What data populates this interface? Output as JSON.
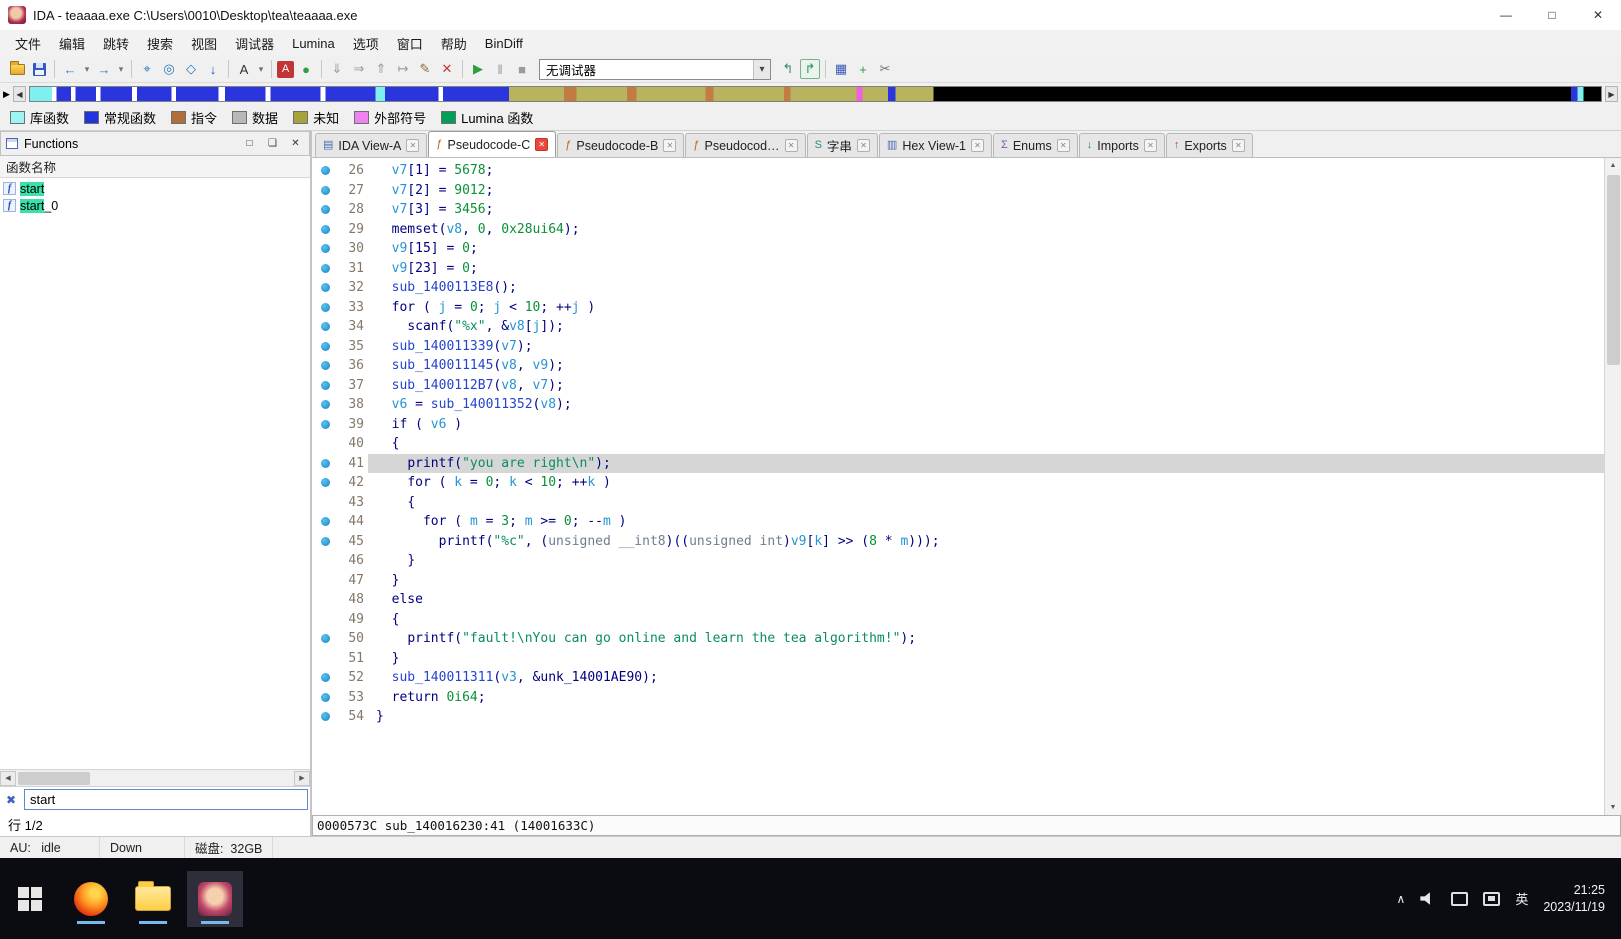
{
  "titlebar": {
    "title": "IDA - teaaaa.exe C:\\Users\\0010\\Desktop\\tea\\teaaaa.exe"
  },
  "menubar": [
    "文件",
    "编辑",
    "跳转",
    "搜索",
    "视图",
    "调试器",
    "Lumina",
    "选项",
    "窗口",
    "帮助",
    "BinDiff"
  ],
  "toolbar": {
    "debugger_label": "无调试器",
    "icons_left": [
      {
        "name": "open-file-icon",
        "cls": "ic-folder"
      },
      {
        "name": "save-icon",
        "cls": "ic-floppy"
      },
      {
        "sep": true
      },
      {
        "name": "nav-back-icon",
        "glyph": "←",
        "color": "#4a78b8"
      },
      {
        "name": "nav-back-history-icon",
        "glyph": "▾",
        "color": "#707070",
        "small": true
      },
      {
        "name": "nav-forward-icon",
        "glyph": "→",
        "color": "#4a78b8"
      },
      {
        "name": "nav-forward-history-icon",
        "glyph": "▾",
        "color": "#707070",
        "small": true
      },
      {
        "sep": true
      },
      {
        "name": "jump-by-name-icon",
        "glyph": "⌖",
        "color": "#2a7ab8"
      },
      {
        "name": "jump-by-xref-icon",
        "glyph": "◎",
        "color": "#2a7ab8"
      },
      {
        "name": "jump-by-address-icon",
        "glyph": "◇",
        "color": "#2a7ab8"
      },
      {
        "name": "jump-next-icon",
        "glyph": "↓",
        "color": "#2255cc"
      },
      {
        "sep": true
      },
      {
        "name": "font-select-icon",
        "glyph": "A",
        "color": "#303030"
      },
      {
        "name": "font-select-menu-icon",
        "glyph": "▾",
        "color": "#707070",
        "small": true
      },
      {
        "sep": true
      },
      {
        "name": "highlight-color-icon",
        "glyph": "A",
        "color": "#ffffff",
        "bg": "#c23535"
      },
      {
        "name": "lumina-status-icon",
        "glyph": "●",
        "color": "#2f9e3f"
      },
      {
        "sep": true
      },
      {
        "name": "step-into-icon",
        "glyph": "⇓",
        "color": "#9a9a9a"
      },
      {
        "name": "step-over-icon",
        "glyph": "⇒",
        "color": "#9a9a9a"
      },
      {
        "name": "run-until-return-icon",
        "glyph": "⇑",
        "color": "#9a9a9a"
      },
      {
        "name": "run-to-cursor-icon",
        "glyph": "↦",
        "color": "#9a9a9a"
      },
      {
        "name": "edit-patch-icon",
        "glyph": "✎",
        "color": "#8a6a3a"
      },
      {
        "name": "cancel-operation-icon",
        "glyph": "✕",
        "color": "#c23535"
      },
      {
        "sep": true
      },
      {
        "name": "start-process-icon",
        "glyph": "▶",
        "color": "#2f9e3f"
      },
      {
        "name": "pause-process-icon",
        "glyph": "‖",
        "color": "#9a9a9a"
      },
      {
        "name": "stop-process-icon",
        "glyph": "■",
        "color": "#9a9a9a"
      }
    ],
    "icons_right": [
      {
        "name": "debugger-options-icon",
        "glyph": "↰",
        "color": "#2f8e6e"
      },
      {
        "name": "open-debugger-icon",
        "glyph": "↱",
        "color": "#2f8e6e",
        "boxed": true
      },
      {
        "sep": true
      },
      {
        "name": "windows-list-icon",
        "glyph": "▦",
        "color": "#3a5ab8"
      },
      {
        "name": "add-breakpoint-icon",
        "glyph": "+",
        "color": "#2f9e3f"
      },
      {
        "name": "script-command-icon",
        "glyph": "✂",
        "color": "#707070"
      }
    ]
  },
  "legend": [
    {
      "label": "库函数",
      "color": "#9ff3f3"
    },
    {
      "label": "常规函数",
      "color": "#2233dd"
    },
    {
      "label": "指令",
      "color": "#b06e3c"
    },
    {
      "label": "数据",
      "color": "#b8b8b8"
    },
    {
      "label": "未知",
      "color": "#a8a23e"
    },
    {
      "label": "外部符号",
      "color": "#ee82ee"
    },
    {
      "label": "Lumina 函数",
      "color": "#00a05a"
    }
  ],
  "functions_panel": {
    "title": "Functions",
    "column_header": "函数名称",
    "rows": [
      {
        "match": "start",
        "rest": "",
        "selected": true
      },
      {
        "match": "start",
        "rest": "_0",
        "selected": false
      }
    ],
    "search_value": "start",
    "row_counter": "行 1/2"
  },
  "tabs": [
    {
      "label": "IDA View-A",
      "active": false,
      "icon": "ida-view"
    },
    {
      "label": "Pseudocode-C",
      "active": true,
      "icon": "pseudocode"
    },
    {
      "label": "Pseudocode-B",
      "active": false,
      "icon": "pseudocode"
    },
    {
      "label": "Pseudocod…",
      "active": false,
      "icon": "pseudocode"
    },
    {
      "label": "字串",
      "active": false,
      "icon": "strings"
    },
    {
      "label": "Hex View-1",
      "active": false,
      "icon": "hex"
    },
    {
      "label": "Enums",
      "active": false,
      "icon": "enums"
    },
    {
      "label": "Imports",
      "active": false,
      "icon": "imports"
    },
    {
      "label": "Exports",
      "active": false,
      "icon": "exports"
    }
  ],
  "code": {
    "status_line": "0000573C sub_140016230:41 (14001633C)",
    "lines": [
      {
        "num": 26,
        "bp": true,
        "hl": false,
        "ind": 2,
        "toks": [
          [
            "v",
            "v7"
          ],
          [
            "p",
            "[1] = "
          ],
          [
            "n",
            "5678"
          ],
          [
            "p",
            ";"
          ]
        ]
      },
      {
        "num": 27,
        "bp": true,
        "hl": false,
        "ind": 2,
        "toks": [
          [
            "v",
            "v7"
          ],
          [
            "p",
            "[2] = "
          ],
          [
            "n",
            "9012"
          ],
          [
            "p",
            ";"
          ]
        ]
      },
      {
        "num": 28,
        "bp": true,
        "hl": false,
        "ind": 2,
        "toks": [
          [
            "v",
            "v7"
          ],
          [
            "p",
            "[3] = "
          ],
          [
            "n",
            "3456"
          ],
          [
            "p",
            ";"
          ]
        ]
      },
      {
        "num": 29,
        "bp": true,
        "hl": false,
        "ind": 2,
        "toks": [
          [
            "p",
            "memset("
          ],
          [
            "v",
            "v8"
          ],
          [
            "p",
            ", "
          ],
          [
            "n",
            "0"
          ],
          [
            "p",
            ", "
          ],
          [
            "n",
            "0x28ui64"
          ],
          [
            "p",
            ");"
          ]
        ]
      },
      {
        "num": 30,
        "bp": true,
        "hl": false,
        "ind": 2,
        "toks": [
          [
            "v",
            "v9"
          ],
          [
            "p",
            "[15] = "
          ],
          [
            "n",
            "0"
          ],
          [
            "p",
            ";"
          ]
        ]
      },
      {
        "num": 31,
        "bp": true,
        "hl": false,
        "ind": 2,
        "toks": [
          [
            "v",
            "v9"
          ],
          [
            "p",
            "[23] = "
          ],
          [
            "n",
            "0"
          ],
          [
            "p",
            ";"
          ]
        ]
      },
      {
        "num": 32,
        "bp": true,
        "hl": false,
        "ind": 2,
        "toks": [
          [
            "f",
            "sub_1400113E8"
          ],
          [
            "p",
            "();"
          ]
        ]
      },
      {
        "num": 33,
        "bp": true,
        "hl": false,
        "ind": 2,
        "toks": [
          [
            "k",
            "for"
          ],
          [
            "p",
            " ( "
          ],
          [
            "v",
            "j"
          ],
          [
            "p",
            " = "
          ],
          [
            "n",
            "0"
          ],
          [
            "p",
            "; "
          ],
          [
            "v",
            "j"
          ],
          [
            "p",
            " < "
          ],
          [
            "n",
            "10"
          ],
          [
            "p",
            "; ++"
          ],
          [
            "v",
            "j"
          ],
          [
            "p",
            " )"
          ]
        ]
      },
      {
        "num": 34,
        "bp": true,
        "hl": false,
        "ind": 4,
        "toks": [
          [
            "p",
            "scanf("
          ],
          [
            "s",
            "\"%x\""
          ],
          [
            "p",
            ", &"
          ],
          [
            "v",
            "v8"
          ],
          [
            "p",
            "["
          ],
          [
            "v",
            "j"
          ],
          [
            "p",
            "]);"
          ]
        ]
      },
      {
        "num": 35,
        "bp": true,
        "hl": false,
        "ind": 2,
        "toks": [
          [
            "f",
            "sub_140011339"
          ],
          [
            "p",
            "("
          ],
          [
            "v",
            "v7"
          ],
          [
            "p",
            ");"
          ]
        ]
      },
      {
        "num": 36,
        "bp": true,
        "hl": false,
        "ind": 2,
        "toks": [
          [
            "f",
            "sub_140011145"
          ],
          [
            "p",
            "("
          ],
          [
            "v",
            "v8"
          ],
          [
            "p",
            ", "
          ],
          [
            "v",
            "v9"
          ],
          [
            "p",
            ");"
          ]
        ]
      },
      {
        "num": 37,
        "bp": true,
        "hl": false,
        "ind": 2,
        "toks": [
          [
            "f",
            "sub_1400112B7"
          ],
          [
            "p",
            "("
          ],
          [
            "v",
            "v8"
          ],
          [
            "p",
            ", "
          ],
          [
            "v",
            "v7"
          ],
          [
            "p",
            ");"
          ]
        ]
      },
      {
        "num": 38,
        "bp": true,
        "hl": false,
        "ind": 2,
        "toks": [
          [
            "v",
            "v6"
          ],
          [
            "p",
            " = "
          ],
          [
            "f",
            "sub_140011352"
          ],
          [
            "p",
            "("
          ],
          [
            "v",
            "v8"
          ],
          [
            "p",
            ");"
          ]
        ]
      },
      {
        "num": 39,
        "bp": true,
        "hl": false,
        "ind": 2,
        "toks": [
          [
            "k",
            "if"
          ],
          [
            "p",
            " ( "
          ],
          [
            "v",
            "v6"
          ],
          [
            "p",
            " )"
          ]
        ]
      },
      {
        "num": 40,
        "bp": false,
        "hl": false,
        "ind": 2,
        "toks": [
          [
            "p",
            "{"
          ]
        ]
      },
      {
        "num": 41,
        "bp": true,
        "hl": true,
        "ind": 4,
        "toks": [
          [
            "p",
            "printf("
          ],
          [
            "s",
            "\"you are right\\n\""
          ],
          [
            "p",
            ");"
          ]
        ]
      },
      {
        "num": 42,
        "bp": true,
        "hl": false,
        "ind": 4,
        "toks": [
          [
            "k",
            "for"
          ],
          [
            "p",
            " ( "
          ],
          [
            "v",
            "k"
          ],
          [
            "p",
            " = "
          ],
          [
            "n",
            "0"
          ],
          [
            "p",
            "; "
          ],
          [
            "v",
            "k"
          ],
          [
            "p",
            " < "
          ],
          [
            "n",
            "10"
          ],
          [
            "p",
            "; ++"
          ],
          [
            "v",
            "k"
          ],
          [
            "p",
            " )"
          ]
        ]
      },
      {
        "num": 43,
        "bp": false,
        "hl": false,
        "ind": 4,
        "toks": [
          [
            "p",
            "{"
          ]
        ]
      },
      {
        "num": 44,
        "bp": true,
        "hl": false,
        "ind": 6,
        "toks": [
          [
            "k",
            "for"
          ],
          [
            "p",
            " ( "
          ],
          [
            "v",
            "m"
          ],
          [
            "p",
            " = "
          ],
          [
            "n",
            "3"
          ],
          [
            "p",
            "; "
          ],
          [
            "v",
            "m"
          ],
          [
            "p",
            " >= "
          ],
          [
            "n",
            "0"
          ],
          [
            "p",
            "; --"
          ],
          [
            "v",
            "m"
          ],
          [
            "p",
            " )"
          ]
        ]
      },
      {
        "num": 45,
        "bp": true,
        "hl": false,
        "ind": 8,
        "toks": [
          [
            "p",
            "printf("
          ],
          [
            "s",
            "\"%c\""
          ],
          [
            "p",
            ", ("
          ],
          [
            "t",
            "unsigned __int8"
          ],
          [
            "p",
            ")(("
          ],
          [
            "t",
            "unsigned int"
          ],
          [
            "p",
            ")"
          ],
          [
            "v",
            "v9"
          ],
          [
            "p",
            "["
          ],
          [
            "v",
            "k"
          ],
          [
            "p",
            "] >> ("
          ],
          [
            "n",
            "8"
          ],
          [
            "p",
            " * "
          ],
          [
            "v",
            "m"
          ],
          [
            "p",
            ")));"
          ]
        ]
      },
      {
        "num": 46,
        "bp": false,
        "hl": false,
        "ind": 4,
        "toks": [
          [
            "p",
            "}"
          ]
        ]
      },
      {
        "num": 47,
        "bp": false,
        "hl": false,
        "ind": 2,
        "toks": [
          [
            "p",
            "}"
          ]
        ]
      },
      {
        "num": 48,
        "bp": false,
        "hl": false,
        "ind": 2,
        "toks": [
          [
            "k",
            "else"
          ]
        ]
      },
      {
        "num": 49,
        "bp": false,
        "hl": false,
        "ind": 2,
        "toks": [
          [
            "p",
            "{"
          ]
        ]
      },
      {
        "num": 50,
        "bp": true,
        "hl": false,
        "ind": 4,
        "toks": [
          [
            "p",
            "printf("
          ],
          [
            "s",
            "\"fault!\\nYou can go online and learn the tea algorithm!\""
          ],
          [
            "p",
            ");"
          ]
        ]
      },
      {
        "num": 51,
        "bp": false,
        "hl": false,
        "ind": 2,
        "toks": [
          [
            "p",
            "}"
          ]
        ]
      },
      {
        "num": 52,
        "bp": true,
        "hl": false,
        "ind": 2,
        "toks": [
          [
            "f",
            "sub_140011311"
          ],
          [
            "p",
            "("
          ],
          [
            "v",
            "v3"
          ],
          [
            "p",
            ", &unk_14001AE90);"
          ]
        ]
      },
      {
        "num": 53,
        "bp": true,
        "hl": false,
        "ind": 2,
        "toks": [
          [
            "k",
            "return"
          ],
          [
            "p",
            " "
          ],
          [
            "n",
            "0i64"
          ],
          [
            "p",
            ";"
          ]
        ]
      },
      {
        "num": 54,
        "bp": true,
        "hl": false,
        "ind": 0,
        "toks": [
          [
            "p",
            "}"
          ]
        ]
      }
    ]
  },
  "statusbar": {
    "au": "AU:   idle",
    "down": "Down",
    "disk": "磁盘:  32GB"
  },
  "taskbar": {
    "lang": "英",
    "time": "21:25",
    "date": "2023/11/19"
  }
}
